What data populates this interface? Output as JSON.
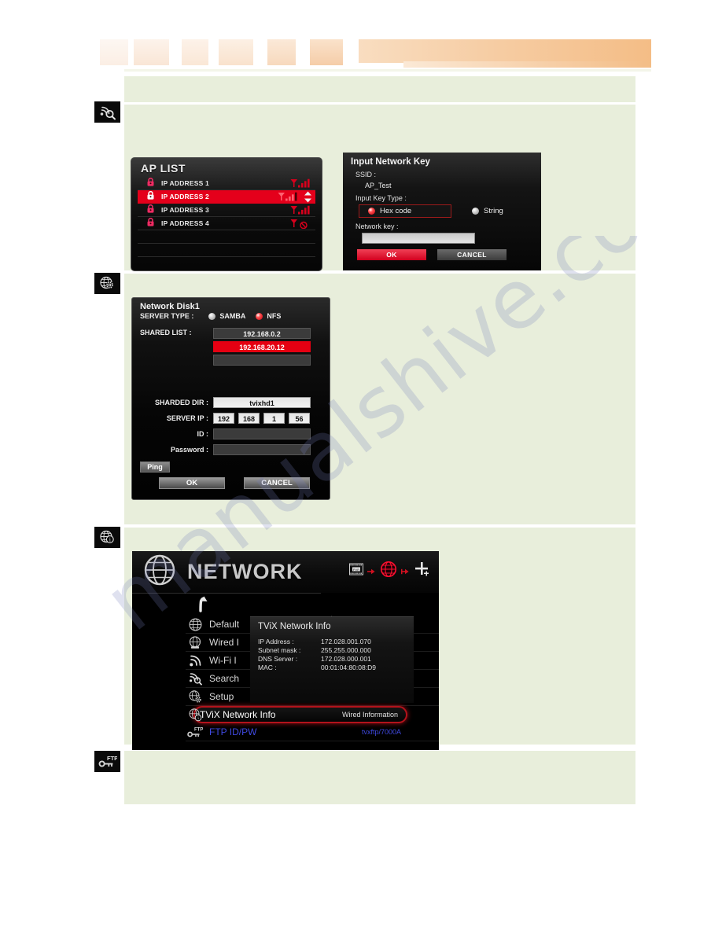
{
  "page": {
    "watermark": "manualshive.com",
    "background": "#ffffff",
    "panel_color": "#e8eedb",
    "accent_red": "#e4001b",
    "accent_orange": "#f4bd86"
  },
  "margin_icons": [
    {
      "name": "wifi-search-icon",
      "alt": "Wi-Fi search"
    },
    {
      "name": "network-setup-icon",
      "alt": "Setup network"
    },
    {
      "name": "network-info-icon",
      "alt": "Network info"
    },
    {
      "name": "ftp-key-icon",
      "alt": "FTP ID/PW"
    }
  ],
  "ap_list": {
    "title": "AP LIST",
    "rows": [
      {
        "label": "IP ADDRESS 1",
        "locked": true,
        "signal": 4,
        "selected": false
      },
      {
        "label": "IP ADDRESS 2",
        "locked": true,
        "signal": 3,
        "selected": true
      },
      {
        "label": "IP ADDRESS 3",
        "locked": true,
        "signal": 4,
        "selected": false
      },
      {
        "label": "IP ADDRESS 4",
        "locked": true,
        "signal": 0,
        "selected": false
      }
    ]
  },
  "network_key": {
    "title": "Input Network Key",
    "ssid_label": "SSID :",
    "ssid_value": "AP_Test",
    "key_type_label": "Input Key Type :",
    "options": [
      {
        "label": "Hex code",
        "selected": true
      },
      {
        "label": "String",
        "selected": false
      }
    ],
    "network_key_label": "Network key :",
    "network_key_value": "",
    "ok_label": "OK",
    "cancel_label": "CANCEL"
  },
  "network_disk": {
    "title": "Network Disk1",
    "server_type_label": "SERVER TYPE :",
    "server_types": [
      {
        "label": "SAMBA",
        "selected": false
      },
      {
        "label": "NFS",
        "selected": true
      }
    ],
    "shared_list_label": "SHARED LIST :",
    "shared_list": [
      {
        "value": "192.168.0.2",
        "selected": false
      },
      {
        "value": "192.168.20.12",
        "selected": true
      },
      {
        "value": "",
        "selected": false
      }
    ],
    "shared_dir_label": "SHARDED DIR :",
    "shared_dir_value": "tvixhd1",
    "server_ip_label": "SERVER IP :",
    "server_ip": [
      "192",
      "168",
      "1",
      "56"
    ],
    "id_label": "ID :",
    "id_value": "",
    "password_label": "Password :",
    "password_value": "",
    "ping_label": "Ping",
    "ok_label": "OK",
    "cancel_label": "CANCEL"
  },
  "network_screen": {
    "title": "NETWORK",
    "header_icons": [
      "pvr-filmstrip-icon",
      "arrow-right-icon",
      "globe-red-icon",
      "arrow-right-icon",
      "plus-icon"
    ],
    "menu": [
      {
        "label": "Default",
        "value": "",
        "icon": "globe-icon",
        "highlight": false
      },
      {
        "label": "Wired I",
        "value": "",
        "icon": "globe-wired-icon",
        "highlight": false
      },
      {
        "label": "Wi-Fi I",
        "value": "",
        "icon": "wifi-icon",
        "highlight": false
      },
      {
        "label": "Search",
        "value": "",
        "icon": "wifi-search-icon",
        "highlight": false
      },
      {
        "label": "Setup",
        "value": "",
        "icon": "globe-gear-icon",
        "highlight": false
      },
      {
        "label": "TViX Network Info",
        "value": "Wired Information",
        "icon": "globe-info-icon",
        "highlight": true
      },
      {
        "label": "FTP ID/PW",
        "value": "tvxftp/7000A",
        "icon": "ftp-key-icon",
        "highlight": false
      }
    ],
    "info_popup": {
      "title": "TViX Network Info",
      "rows": [
        {
          "key": "IP Address :",
          "value": "172.028.001.070"
        },
        {
          "key": "Subnet mask :",
          "value": "255.255.000.000"
        },
        {
          "key": "DNS Server :",
          "value": "172.028.000.001"
        },
        {
          "key": "MAC :",
          "value": "00:01:04:80:08:D9"
        }
      ]
    }
  }
}
